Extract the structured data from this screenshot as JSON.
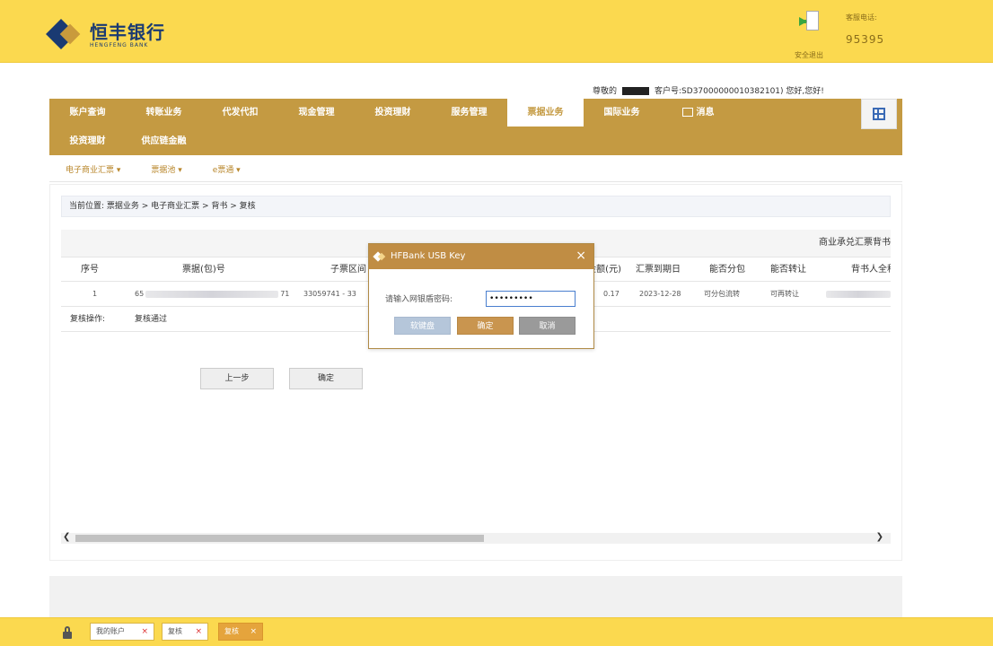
{
  "header": {
    "bank_name_cn": "恒丰银行",
    "bank_name_en": "HENGFENG BANK",
    "logout_label": "安全退出",
    "hotline_label": "客服电话:",
    "hotline_number": "95395"
  },
  "user_info": {
    "greeting": "尊敬的",
    "customer_no": "客户号:SD37000000010382101) 您好,您好!"
  },
  "main_nav": {
    "row1": [
      "账户查询",
      "转账业务",
      "代发代扣",
      "现金管理",
      "投资理财",
      "服务管理",
      "票据业务",
      "国际业务",
      "消息"
    ],
    "row2": [
      "投资理财",
      "供应链金融"
    ],
    "active": "票据业务"
  },
  "sub_nav": {
    "items": [
      "电子商业汇票 ▾",
      "票据池 ▾",
      "e票通 ▾"
    ]
  },
  "breadcrumb": "当前位置: 票据业务 > 电子商业汇票 > 背书 > 复核",
  "table": {
    "caption": "商业承兑汇票背书",
    "headers": [
      "序号",
      "票据(包)号",
      "子票区间",
      "金额(元)",
      "汇票到期日",
      "能否分包",
      "能否转让",
      "背书人全称"
    ],
    "row": {
      "index": "1",
      "bill_no": "65",
      "bill_no_tail": "71",
      "sub_range": "33059741 - 33",
      "amount": "0.17",
      "due_date": "2023-12-28",
      "split": "可分包流转",
      "transfer": "可再转让"
    },
    "operation_label": "复核操作:",
    "operation_value": "复核通过"
  },
  "buttons": {
    "prev": "上一步",
    "confirm": "确定"
  },
  "dialog": {
    "title": "HFBank USB Key",
    "close": "×",
    "prompt": "请输入网银盾密码:",
    "password_value": "•••••••••",
    "keyboard_button": "软键盘",
    "ok_button": "确定",
    "cancel_button": "取消"
  },
  "taskbar": {
    "tabs": [
      "我的账户",
      "复核",
      "复核"
    ],
    "active_index": 2,
    "close_glyph": "×"
  }
}
